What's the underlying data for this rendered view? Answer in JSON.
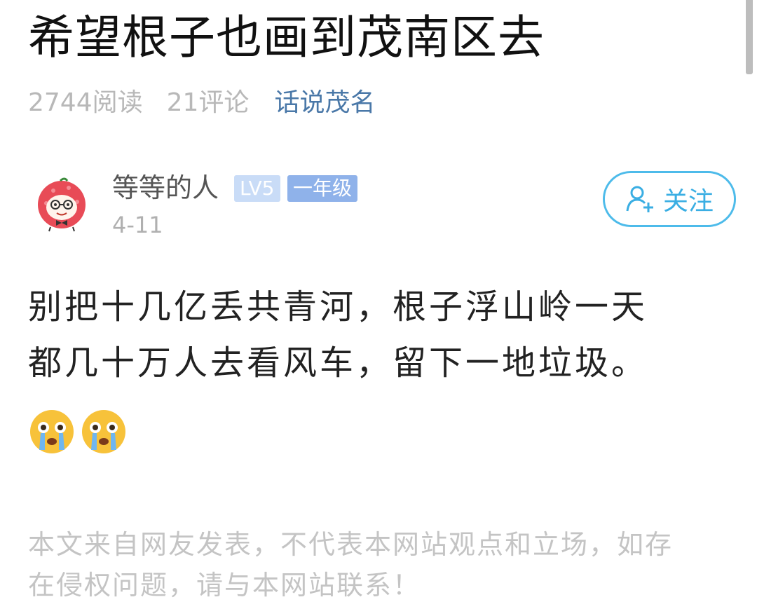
{
  "article": {
    "title": "希望根子也画到茂南区去",
    "reads": "2744阅读",
    "comments": "21评论",
    "topic": "话说茂名"
  },
  "author": {
    "name": "等等的人",
    "level_badge": "LV5",
    "grade_badge": "一年级",
    "date": "4-11",
    "avatar_icon": "lychee-mascot-avatar-icon"
  },
  "follow_button": {
    "label": "关注",
    "icon": "add-user-icon",
    "color": "#4dbbea"
  },
  "content": {
    "lines": [
      "别把十几亿丢共青河，根子浮山岭一天",
      "都几十万人去看风车，留下一地垃圾。"
    ],
    "emojis": [
      "crying-face-emoji",
      "crying-face-emoji"
    ]
  },
  "disclaimer": {
    "lines": [
      "本文来自网友发表，不代表本网站观点和立场，如存",
      "在侵权问题，请与本网站联系！"
    ]
  }
}
